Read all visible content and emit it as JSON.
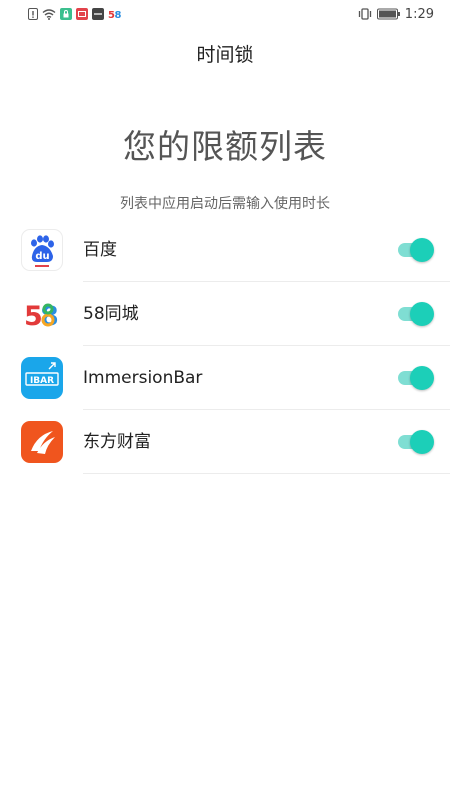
{
  "status_bar": {
    "time": "1:29",
    "left_icons": [
      "alert-icon",
      "wifi-icon",
      "lock-app-icon",
      "mail-app-icon",
      "camera-app-icon",
      "app-58-icon"
    ],
    "right_icons": [
      "vibrate-icon",
      "battery-icon"
    ]
  },
  "header": {
    "title": "时间锁"
  },
  "main": {
    "headline": "您的限额列表",
    "subtitle": "列表中应用启动后需输入使用时长"
  },
  "apps": [
    {
      "name": "百度",
      "icon": "baidu-icon",
      "enabled": true
    },
    {
      "name": "58同城",
      "icon": "58tongcheng-icon",
      "enabled": true
    },
    {
      "name": "ImmersionBar",
      "icon": "immersionbar-icon",
      "enabled": true
    },
    {
      "name": "东方财富",
      "icon": "dongfangcaifu-icon",
      "enabled": true
    }
  ],
  "colors": {
    "toggle_knob": "#1ccfb8",
    "toggle_track": "#7fded3",
    "baidu_blue": "#2d63e8",
    "immersionbar_blue": "#1aa6ea",
    "dongfang_orange": "#f0551e"
  },
  "icon_text": {
    "baidu": "du",
    "tongcheng_5": "5",
    "tongcheng_8": "8",
    "immersionbar": "IBAR"
  }
}
